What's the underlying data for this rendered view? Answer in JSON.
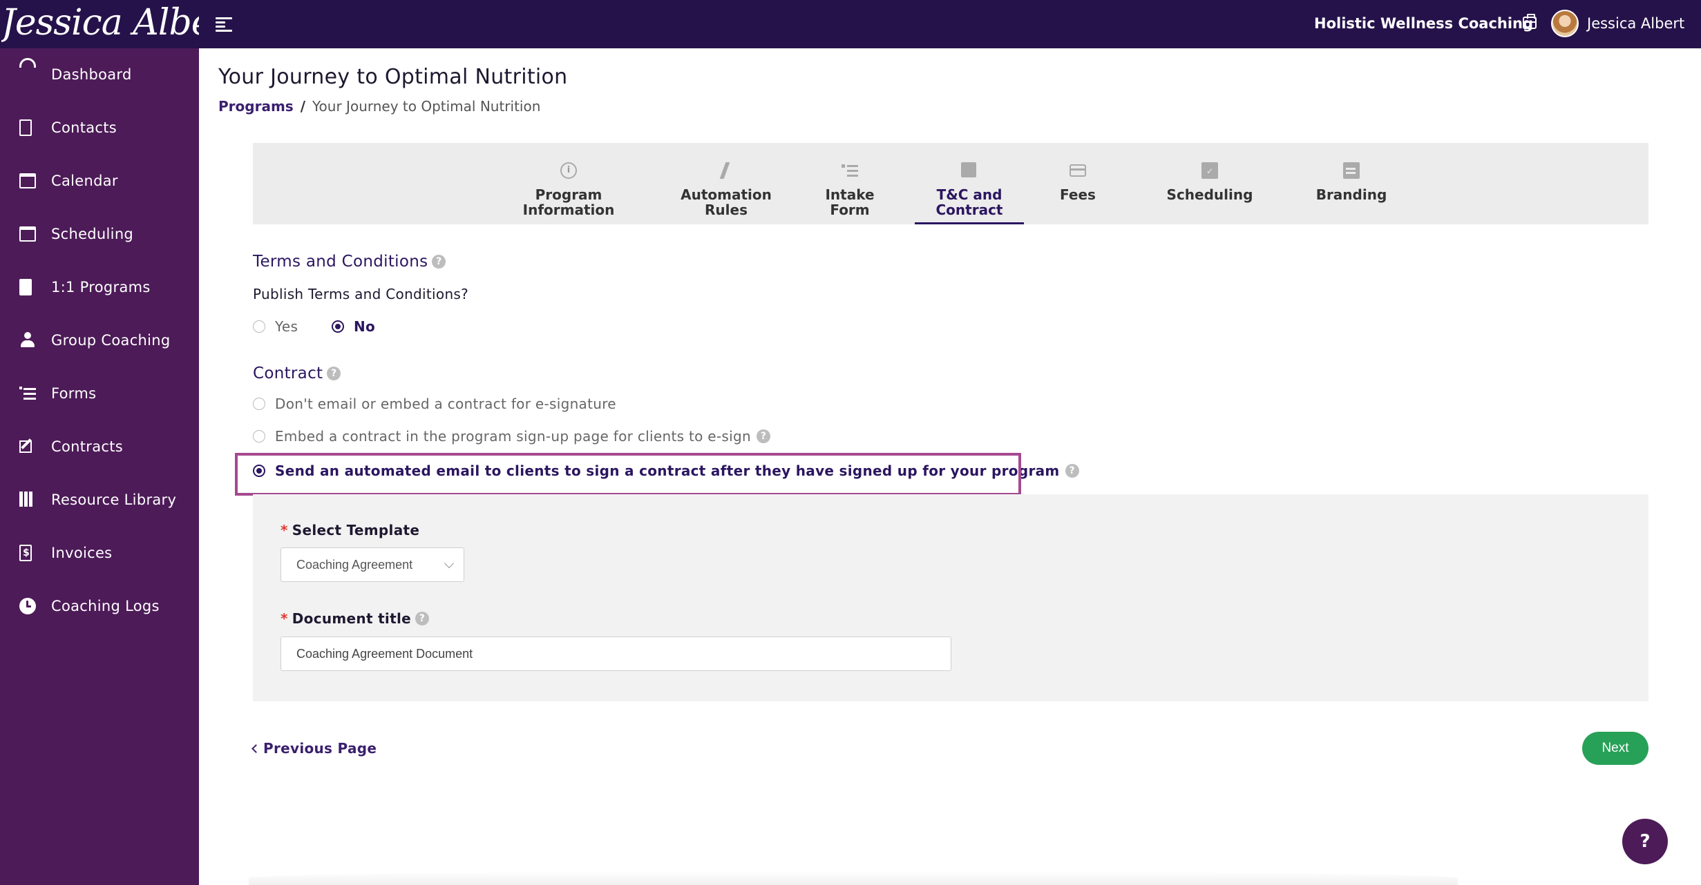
{
  "header": {
    "logo_text": "Jessica Albert",
    "business_name": "Holistic Wellness Coaching",
    "user_name": "Jessica Albert"
  },
  "sidebar": {
    "items": [
      {
        "label": "Dashboard",
        "icon": "dashboard-icon"
      },
      {
        "label": "Contacts",
        "icon": "contacts-icon"
      },
      {
        "label": "Calendar",
        "icon": "calendar-icon"
      },
      {
        "label": "Scheduling",
        "icon": "scheduling-icon"
      },
      {
        "label": "1:1 Programs",
        "icon": "book-icon"
      },
      {
        "label": "Group Coaching",
        "icon": "group-icon"
      },
      {
        "label": "Forms",
        "icon": "forms-icon"
      },
      {
        "label": "Contracts",
        "icon": "contracts-icon"
      },
      {
        "label": "Resource Library",
        "icon": "library-icon"
      },
      {
        "label": "Invoices",
        "icon": "invoice-icon"
      },
      {
        "label": "Coaching Logs",
        "icon": "clock-icon"
      }
    ]
  },
  "page": {
    "title": "Your Journey to Optimal Nutrition",
    "breadcrumb": {
      "parent": "Programs",
      "separator": "/",
      "current": "Your Journey to Optimal Nutrition"
    }
  },
  "tabs": [
    {
      "label": "Program\nInformation",
      "icon": "info-icon",
      "active": false
    },
    {
      "label": "Automation\nRules",
      "icon": "bolt-icon",
      "active": false
    },
    {
      "label": "Intake\nForm",
      "icon": "checklist-icon",
      "active": false
    },
    {
      "label": "T&C and\nContract",
      "icon": "signature-icon",
      "active": true
    },
    {
      "label": "Fees",
      "icon": "card-icon",
      "active": false
    },
    {
      "label": "Scheduling",
      "icon": "calendar-check-icon",
      "active": false
    },
    {
      "label": "Branding",
      "icon": "branding-icon",
      "active": false
    }
  ],
  "terms": {
    "title": "Terms and Conditions",
    "publish_label": "Publish Terms and Conditions?",
    "options": [
      {
        "label": "Yes",
        "checked": false
      },
      {
        "label": "No",
        "checked": true
      }
    ]
  },
  "contract": {
    "title": "Contract",
    "options": [
      {
        "label": "Don't email or embed a contract for e-signature",
        "checked": false
      },
      {
        "label": "Embed a contract in the program sign-up page for clients to e-sign",
        "checked": false
      },
      {
        "label": "Send an automated email to clients to sign a contract after they have signed up for your program",
        "checked": true
      }
    ],
    "template_label": "Select Template",
    "template_value": "Coaching Agreement",
    "document_title_label": "Document title",
    "document_title_value": "Coaching Agreement Document",
    "required_mark": "*",
    "help_glyph": "?"
  },
  "footer": {
    "previous_label": "Previous Page",
    "next_label": "Next",
    "help_fab": "?"
  },
  "colors": {
    "topbar": "#25124a",
    "sidebar": "#4d1b58",
    "accent": "#2b1660",
    "next_button": "#27a157",
    "highlight": "#a54a8f"
  }
}
